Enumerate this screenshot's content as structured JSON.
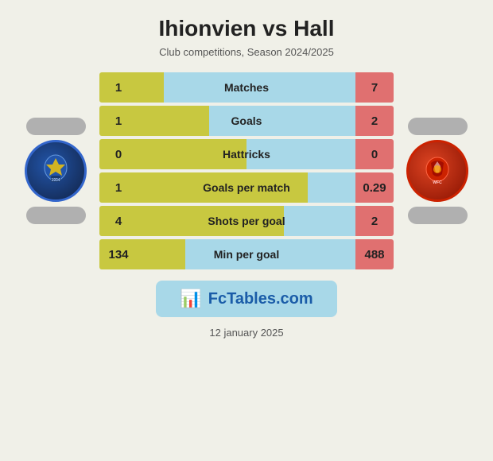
{
  "header": {
    "title": "Ihionvien vs Hall",
    "subtitle": "Club competitions, Season 2024/2025"
  },
  "stats": [
    {
      "label": "Matches",
      "left": "1",
      "right": "7",
      "left_pct": 12
    },
    {
      "label": "Goals",
      "left": "1",
      "right": "2",
      "left_pct": 33
    },
    {
      "label": "Hattricks",
      "left": "0",
      "right": "0",
      "left_pct": 50
    },
    {
      "label": "Goals per match",
      "left": "1",
      "right": "0.29",
      "left_pct": 78
    },
    {
      "label": "Shots per goal",
      "left": "4",
      "right": "2",
      "left_pct": 67
    },
    {
      "label": "Min per goal",
      "left": "134",
      "right": "488",
      "left_pct": 22
    }
  ],
  "banner": {
    "icon": "📊",
    "text": "FcTables.com"
  },
  "date": "12 january 2025"
}
